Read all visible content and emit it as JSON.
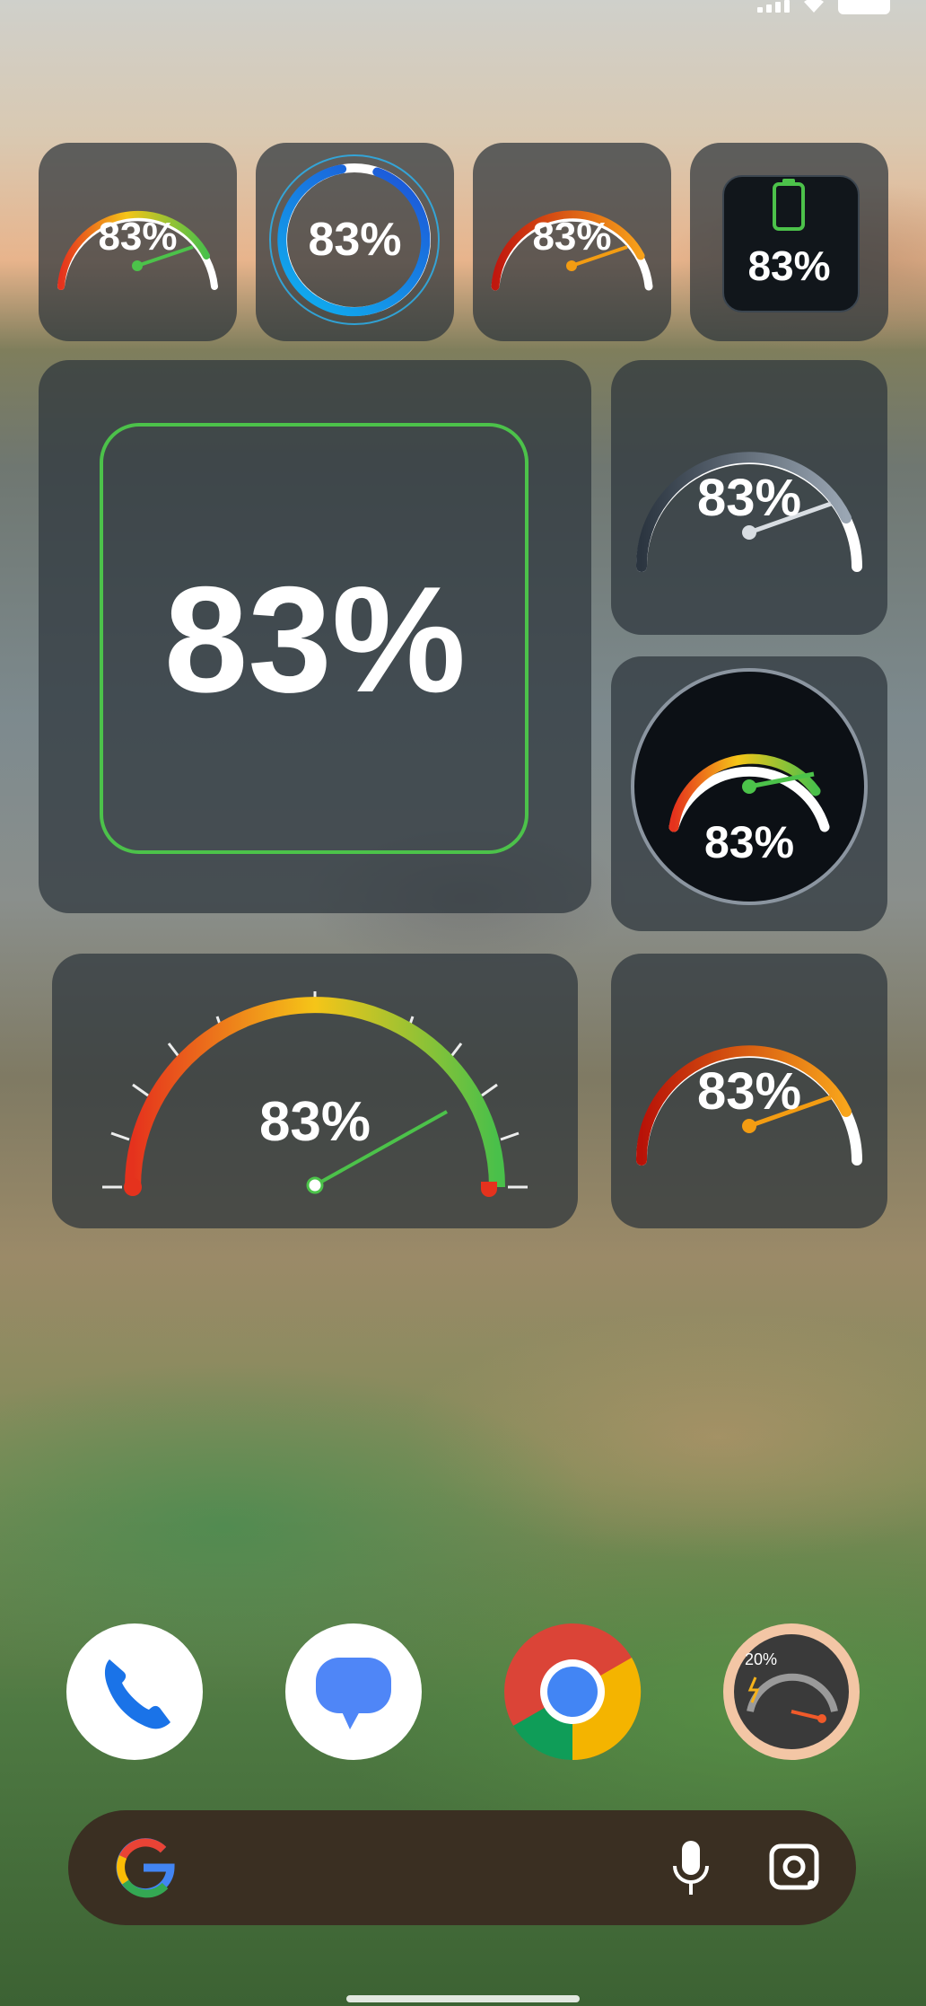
{
  "status_bar": {
    "signal_icon": "signal-icon",
    "wifi_icon": "wifi-icon",
    "battery_icon": "battery-icon"
  },
  "widgets": {
    "small_rainbow": {
      "value": "83%",
      "fill": 0.83
    },
    "small_blue_ring": {
      "value": "83%",
      "fill": 0.83
    },
    "small_orange": {
      "value": "83%",
      "fill": 0.83
    },
    "small_battery": {
      "value": "83%",
      "fill": 0.83,
      "icon": "battery-icon"
    },
    "large_square": {
      "value": "83%",
      "fill": 0.83
    },
    "medium_grey": {
      "value": "83%",
      "fill": 0.83
    },
    "medium_dial": {
      "value": "83%",
      "fill": 0.83
    },
    "wide_rainbow": {
      "value": "83%",
      "fill": 0.83
    },
    "medium_orange": {
      "value": "83%",
      "fill": 0.83
    }
  },
  "dock": {
    "apps": [
      {
        "name": "Phone",
        "icon": "phone-icon"
      },
      {
        "name": "Messages",
        "icon": "messages-icon"
      },
      {
        "name": "Chrome",
        "icon": "chrome-icon"
      },
      {
        "name": "Battery Gauge",
        "icon": "gauge-icon",
        "badge": "20%"
      }
    ]
  },
  "search_bar": {
    "google_icon": "google-icon",
    "mic_icon": "mic-icon",
    "lens_icon": "lens-icon"
  },
  "colors": {
    "green": "#4cc24a",
    "blue": "#1e88e5",
    "orange": "#f39c12",
    "red": "#d92c1c",
    "widget_bg": "#2c343c"
  }
}
